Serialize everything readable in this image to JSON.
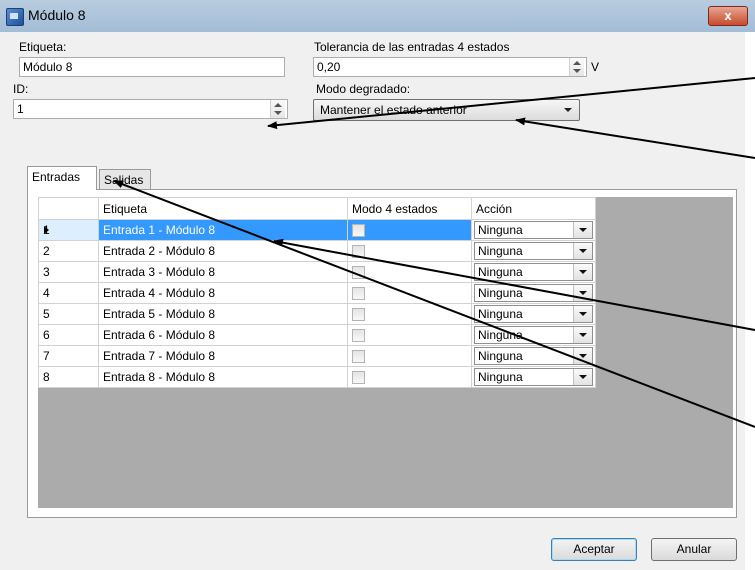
{
  "window": {
    "title": "Módulo 8",
    "close_glyph": "x"
  },
  "form": {
    "etiqueta_label": "Etiqueta:",
    "etiqueta_value": "Módulo 8",
    "tolerancia_label": "Tolerancia de las entradas 4 estados",
    "tolerancia_value": "0,20",
    "tolerancia_unit": "V",
    "id_label": "ID:",
    "id_value": "1",
    "modo_label": "Modo degradado:",
    "modo_value": "Mantener el estado anterior"
  },
  "tabs": [
    {
      "label": "Entradas",
      "active": true
    },
    {
      "label": "Salidas",
      "active": false
    }
  ],
  "grid": {
    "columns": [
      "Etiqueta",
      "Modo 4 estados",
      "Acción"
    ],
    "rows": [
      {
        "num": "1",
        "label": "Entrada 1 - Módulo 8",
        "modo4": false,
        "accion": "Ninguna",
        "selected": true
      },
      {
        "num": "2",
        "label": "Entrada 2 - Módulo 8",
        "modo4": false,
        "accion": "Ninguna",
        "selected": false
      },
      {
        "num": "3",
        "label": "Entrada 3 - Módulo 8",
        "modo4": false,
        "accion": "Ninguna",
        "selected": false
      },
      {
        "num": "4",
        "label": "Entrada 4 - Módulo 8",
        "modo4": false,
        "accion": "Ninguna",
        "selected": false
      },
      {
        "num": "5",
        "label": "Entrada 5 - Módulo 8",
        "modo4": false,
        "accion": "Ninguna",
        "selected": false
      },
      {
        "num": "6",
        "label": "Entrada 6 - Módulo 8",
        "modo4": false,
        "accion": "Ninguna",
        "selected": false
      },
      {
        "num": "7",
        "label": "Entrada 7 - Módulo 8",
        "modo4": false,
        "accion": "Ninguna",
        "selected": false
      },
      {
        "num": "8",
        "label": "Entrada 8 - Módulo 8",
        "modo4": false,
        "accion": "Ninguna",
        "selected": false
      }
    ]
  },
  "buttons": {
    "accept": "Aceptar",
    "cancel": "Anular"
  },
  "icons": {
    "app": "module-window-icon",
    "close": "close-icon",
    "spin": "spinner-icon",
    "dropdown": "chevron-down-icon",
    "row_pointer": "row-pointer-icon"
  },
  "colors": {
    "selection": "#3399ff",
    "titlebar": "#b0c6dc",
    "close": "#c74b2f",
    "annotation": "#000000"
  }
}
